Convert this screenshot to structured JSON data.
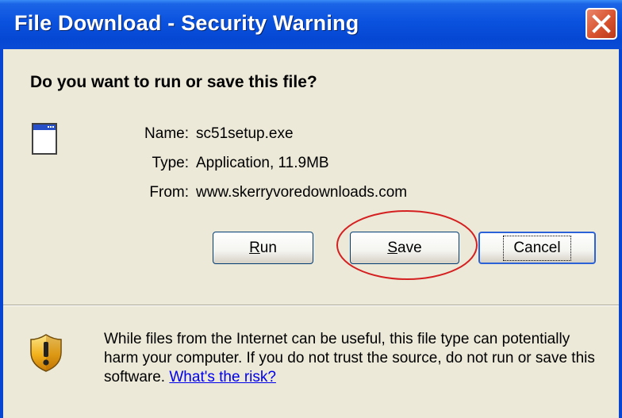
{
  "window": {
    "title": "File Download - Security Warning",
    "close_icon": "close-x-icon"
  },
  "dialog": {
    "question": "Do you want to run or save this file?",
    "file_icon": "application-window-icon",
    "details": {
      "name_label": "Name:",
      "name_value": "sc51setup.exe",
      "type_label": "Type:",
      "type_value": "Application, 11.9MB",
      "from_label": "From:",
      "from_value": "www.skerryvoredownloads.com"
    },
    "buttons": {
      "run": {
        "mnemonic": "R",
        "rest": "un"
      },
      "save": {
        "mnemonic": "S",
        "rest": "ave"
      },
      "cancel": {
        "label": "Cancel"
      }
    },
    "warning": {
      "icon": "shield-warning-icon",
      "text": "While files from the Internet can be useful, this file type can potentially harm your computer. If you do not trust the source, do not run or save this software.",
      "link": "What's the risk?"
    }
  },
  "colors": {
    "titlebar": "#0a52de",
    "dialog_bg": "#ece9d8",
    "close_button": "#d8532f",
    "annotation_circle": "#d42020",
    "link": "#0000ee"
  }
}
